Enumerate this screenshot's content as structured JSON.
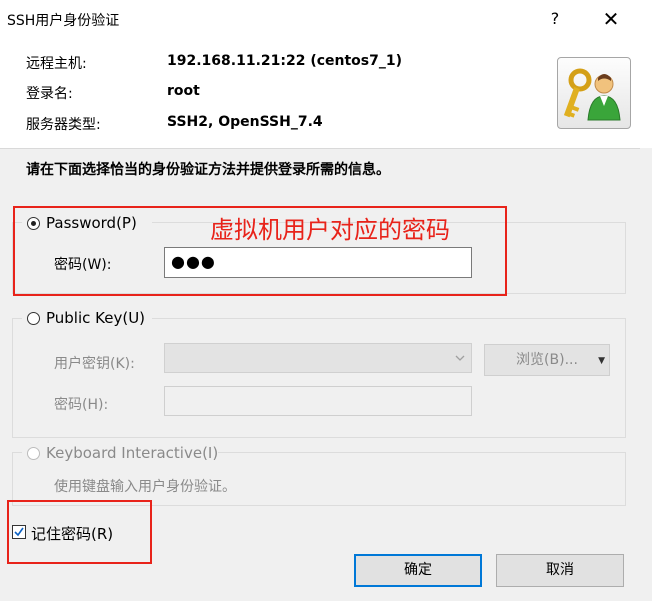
{
  "window": {
    "title": "SSH用户身份验证",
    "help_label": "?",
    "close_label": "✕"
  },
  "info": {
    "host_label": "远程主机:",
    "host_value": "192.168.11.21:22 (centos7_1)",
    "user_label": "登录名:",
    "user_value": "root",
    "server_type_label": "服务器类型:",
    "server_type_value": "SSH2, OpenSSH_7.4"
  },
  "instruction": "请在下面选择恰当的身份验证方法并提供登录所需的信息。",
  "password_option": {
    "label": "Password(P)",
    "selected": true,
    "field_label": "密码(W):",
    "field_value": "●●●"
  },
  "annotation_text": "虚拟机用户对应的密码",
  "public_key_option": {
    "label": "Public Key(U)",
    "selected": false,
    "key_label": "用户密钥(K):",
    "key_value": "",
    "browse_label": "浏览(B)...",
    "passphrase_label": "密码(H):",
    "passphrase_value": ""
  },
  "keyboard_option": {
    "label": "Keyboard Interactive(I)",
    "selected": false,
    "description": "使用键盘输入用户身份验证。"
  },
  "remember": {
    "label": "记住密码(R)",
    "checked": true
  },
  "buttons": {
    "ok_label": "确定",
    "cancel_label": "取消"
  },
  "colors": {
    "annotation_red": "#e8231a",
    "primary_button_border": "#0078d7"
  },
  "icons": {
    "keys_user": "keys-user-icon",
    "dropdown": "chevron-down-icon"
  }
}
